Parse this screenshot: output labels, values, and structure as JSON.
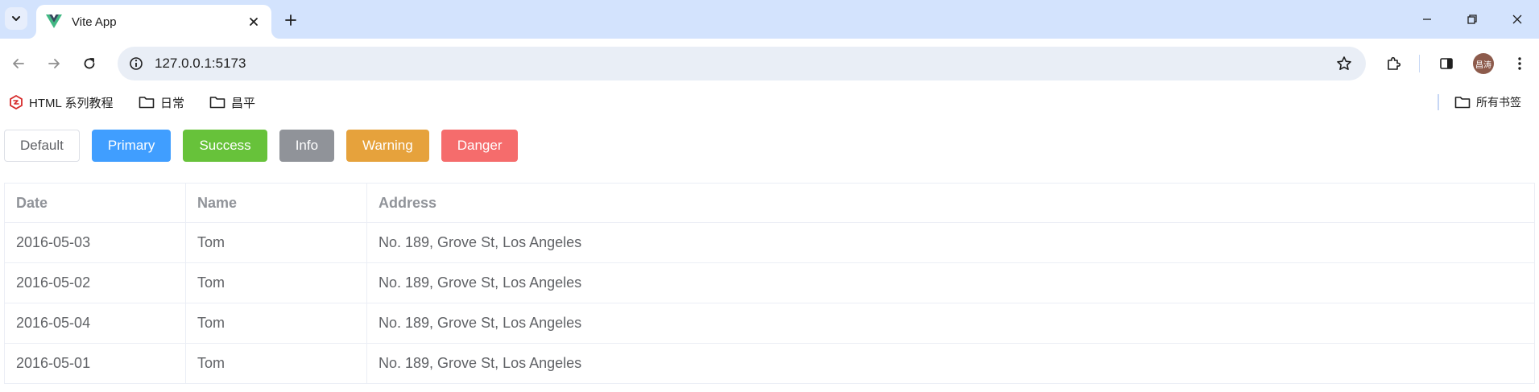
{
  "browser": {
    "tab_title": "Vite App",
    "url": "127.0.0.1:5173",
    "profile_initials": "昌涛",
    "bookmarks": [
      {
        "label": "HTML 系列教程",
        "icon": "tutorial-logo-icon"
      },
      {
        "label": "日常",
        "icon": "folder-icon"
      },
      {
        "label": "昌平",
        "icon": "folder-icon"
      }
    ],
    "all_bookmarks_label": "所有书签"
  },
  "buttons": [
    {
      "label": "Default",
      "type": "default"
    },
    {
      "label": "Primary",
      "type": "primary",
      "color": "#409eff"
    },
    {
      "label": "Success",
      "type": "success",
      "color": "#67c23a"
    },
    {
      "label": "Info",
      "type": "info",
      "color": "#909399"
    },
    {
      "label": "Warning",
      "type": "warning",
      "color": "#e6a23c"
    },
    {
      "label": "Danger",
      "type": "danger",
      "color": "#f56c6c"
    }
  ],
  "table": {
    "headers": [
      "Date",
      "Name",
      "Address"
    ],
    "rows": [
      {
        "date": "2016-05-03",
        "name": "Tom",
        "address": "No. 189, Grove St, Los Angeles"
      },
      {
        "date": "2016-05-02",
        "name": "Tom",
        "address": "No. 189, Grove St, Los Angeles"
      },
      {
        "date": "2016-05-04",
        "name": "Tom",
        "address": "No. 189, Grove St, Los Angeles"
      },
      {
        "date": "2016-05-01",
        "name": "Tom",
        "address": "No. 189, Grove St, Los Angeles"
      }
    ]
  }
}
